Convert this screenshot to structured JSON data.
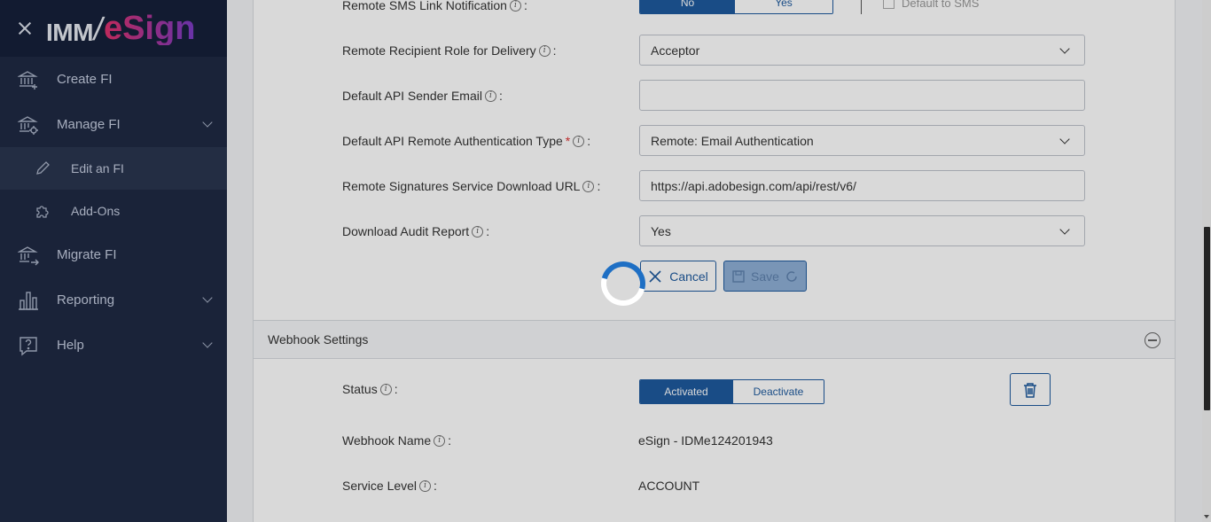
{
  "sidebar": {
    "logo_left": "IMM",
    "logo_slash": "/",
    "logo_right": "eSign",
    "items": [
      {
        "label": "Create FI"
      },
      {
        "label": "Manage FI"
      },
      {
        "label": "Edit an FI"
      },
      {
        "label": "Add-Ons"
      },
      {
        "label": "Migrate FI"
      },
      {
        "label": "Reporting"
      },
      {
        "label": "Help"
      }
    ]
  },
  "form": {
    "sms": {
      "label": "Remote SMS Link Notification",
      "no": "No",
      "yes": "Yes",
      "checkbox_label": "Default to SMS"
    },
    "role": {
      "label": "Remote Recipient Role for Delivery",
      "value": "Acceptor"
    },
    "sender_email": {
      "label": "Default API Sender Email",
      "value": ""
    },
    "auth_type": {
      "label": "Default API Remote Authentication Type",
      "required": "*",
      "value": "Remote: Email Authentication"
    },
    "download_url": {
      "label": "Remote Signatures Service Download URL",
      "value": "https://api.adobesign.com/api/rest/v6/"
    },
    "audit": {
      "label": "Download Audit Report",
      "value": "Yes"
    },
    "cancel_label": "Cancel",
    "save_label": "Save"
  },
  "webhook": {
    "title": "Webhook Settings",
    "status": {
      "label": "Status",
      "activated": "Activated",
      "deactivate": "Deactivate"
    },
    "name": {
      "label": "Webhook Name",
      "value": "eSign - IDMe124201943"
    },
    "service_level": {
      "label": "Service Level",
      "value": "ACCOUNT"
    }
  },
  "colon": ":",
  "info_glyph": "i",
  "colors": {
    "primary": "#1e5a9e",
    "sidebar_bg": "#1f2a44",
    "spinner": "#1e6fc4"
  }
}
